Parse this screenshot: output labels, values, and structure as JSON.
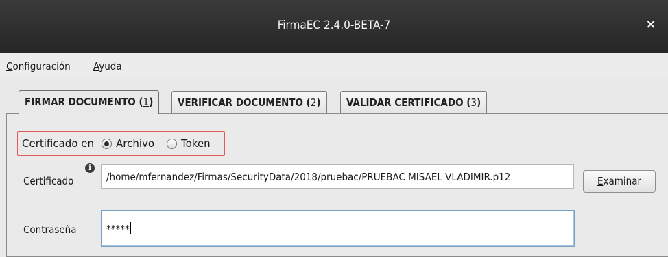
{
  "window": {
    "title": "FirmaEC 2.4.0-BETA-7",
    "close_glyph": "×"
  },
  "menu": {
    "items": [
      {
        "mnemonic": "C",
        "rest": "onfiguración"
      },
      {
        "mnemonic": "A",
        "rest": "yuda"
      }
    ]
  },
  "tabs": [
    {
      "label": "FIRMAR DOCUMENTO (",
      "mnemonic": "1",
      "close": ")",
      "active": true
    },
    {
      "label": "VERIFICAR DOCUMENTO (",
      "mnemonic": "2",
      "close": ")",
      "active": false
    },
    {
      "label": "VALIDAR CERTIFICADO (",
      "mnemonic": "3",
      "close": ")",
      "active": false
    }
  ],
  "certificate_mode": {
    "label": "Certificado en",
    "options": [
      {
        "label": "Archivo",
        "selected": true
      },
      {
        "label": "Token",
        "selected": false
      }
    ],
    "highlight_color": "#e05a5a"
  },
  "certificate": {
    "label": "Certificado",
    "info_icon": "info-icon",
    "value": "/home/mfernandez/Firmas/SecurityData/2018/pruebac/PRUEBAC MISAEL VLADIMIR.p12",
    "browse_button": {
      "mnemonic": "E",
      "rest": "xaminar"
    }
  },
  "password": {
    "label": "Contraseña",
    "value": "*****"
  }
}
